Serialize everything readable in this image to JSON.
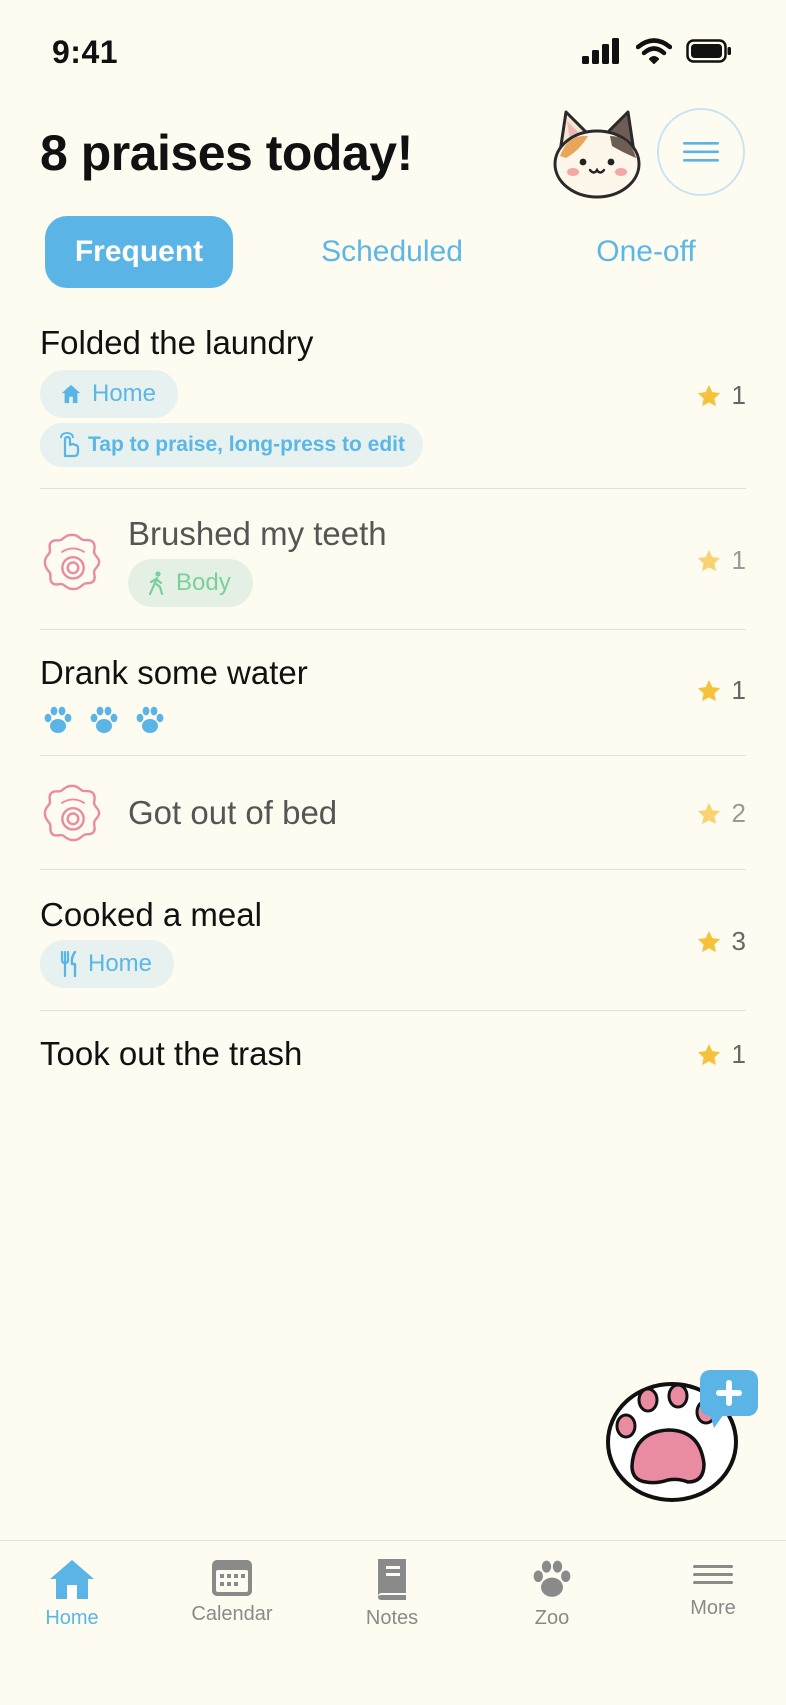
{
  "status_bar": {
    "time": "9:41"
  },
  "header": {
    "title": "8 praises today!"
  },
  "tabs": [
    {
      "label": "Frequent",
      "active": true
    },
    {
      "label": "Scheduled",
      "active": false
    },
    {
      "label": "One-off",
      "active": false
    }
  ],
  "items": [
    {
      "title": "Folded the laundry",
      "tag": {
        "icon": "house-icon",
        "label": "Home"
      },
      "hint": "Tap to praise, long-press to edit",
      "stars": "1",
      "done": false
    },
    {
      "title": "Brushed my teeth",
      "tag": {
        "icon": "walking-icon",
        "label": "Body"
      },
      "stars": "1",
      "done": true,
      "stamp_icon": "hanamaru-stamp-icon"
    },
    {
      "title": "Drank some water",
      "paws": 3,
      "stars": "1",
      "done": false
    },
    {
      "title": "Got out of bed",
      "stars": "2",
      "done": true,
      "stamp_icon": "hanamaru-stamp-icon"
    },
    {
      "title": "Cooked a meal",
      "tag": {
        "icon": "fork-knife-icon",
        "label": "Home"
      },
      "stars": "3",
      "done": false
    },
    {
      "title": "Took out the trash",
      "stars": "1",
      "done": false
    }
  ],
  "tab_bar": [
    {
      "label": "Home",
      "icon": "house-icon",
      "active": true
    },
    {
      "label": "Calendar",
      "icon": "calendar-icon",
      "active": false
    },
    {
      "label": "Notes",
      "icon": "notebook-icon",
      "active": false
    },
    {
      "label": "Zoo",
      "icon": "paw-icon",
      "active": false
    },
    {
      "label": "More",
      "icon": "menu-lines-icon",
      "active": false
    }
  ],
  "colors": {
    "accent": "#5ab5e6",
    "background": "#fefbf1",
    "star": "#f5c33b",
    "stamp": "#e98ca2",
    "body_tag": "#7bcf9c"
  }
}
